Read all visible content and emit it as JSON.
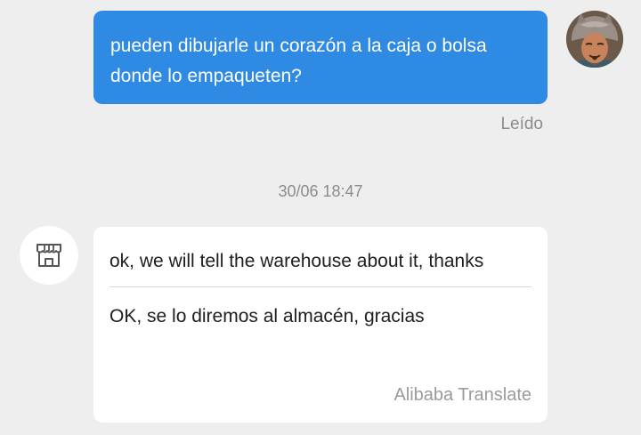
{
  "outgoing_message": {
    "text": "pueden dibujarle un corazón a la caja o bolsa donde lo empaqueten?",
    "status": "Leído",
    "bubble_color": "#2f8ae4"
  },
  "timestamp": "30/06 18:47",
  "incoming_message": {
    "original_text": "ok, we will tell the warehouse about it, thanks",
    "translated_text": "OK, se lo diremos al almacén, gracias",
    "translation_credit": "Alibaba Translate",
    "sender_icon": "store-icon"
  },
  "user_avatar": {
    "icon": "user-avatar"
  }
}
